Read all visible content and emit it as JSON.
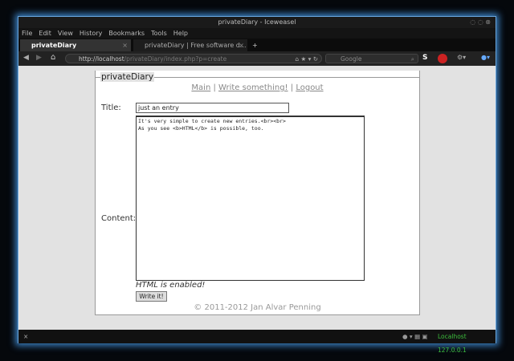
{
  "window": {
    "title": "privateDiary - Iceweasel"
  },
  "menu": [
    "File",
    "Edit",
    "View",
    "History",
    "Bookmarks",
    "Tools",
    "Help"
  ],
  "tabs": [
    {
      "label": "privateDiary"
    },
    {
      "label": "privateDiary | Free software d..."
    }
  ],
  "navbar": {
    "url_host": "http://localhost",
    "url_path": "/privateDiary/index.php?p=create",
    "search_placeholder": "Google"
  },
  "page": {
    "legend": "privateDiary",
    "nav": [
      "Main",
      "Write something!",
      "Logout"
    ],
    "sep": "|",
    "title_label": "Title:",
    "title_value": "just an entry",
    "content_label": "Content:",
    "content_value": "It's very simple to create new entries.<br><br>\nAs you see <b>HTML</b> is possible, too.",
    "hint": "HTML is enabled!",
    "submit": "Write it!",
    "footer": "© 2011-2012 Jan Alvar Penning"
  },
  "status": {
    "text": "Localhost 127.0.0.1",
    "color": "#3dbf3d"
  }
}
